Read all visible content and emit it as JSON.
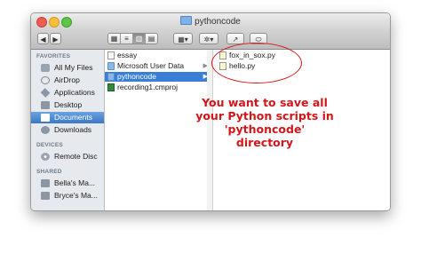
{
  "window": {
    "title": "pythoncode"
  },
  "toolbar": {
    "back": "◀",
    "forward": "▶",
    "view_modes": [
      "▦",
      "≡",
      "▥",
      "▤"
    ],
    "arrange": "▦▾",
    "action": "✲▾",
    "share": "↗",
    "tags": "⬭"
  },
  "sidebar": {
    "favorites_header": "FAVORITES",
    "favorites": [
      {
        "label": "All My Files",
        "icon": "all-files-icon"
      },
      {
        "label": "AirDrop",
        "icon": "airdrop-icon"
      },
      {
        "label": "Applications",
        "icon": "applications-icon"
      },
      {
        "label": "Desktop",
        "icon": "desktop-icon"
      },
      {
        "label": "Documents",
        "icon": "documents-icon",
        "selected": true
      },
      {
        "label": "Downloads",
        "icon": "downloads-icon"
      }
    ],
    "devices_header": "DEVICES",
    "devices": [
      {
        "label": "Remote Disc",
        "icon": "disc-icon"
      }
    ],
    "shared_header": "SHARED",
    "shared": [
      {
        "label": "Bella's Ma...",
        "icon": "computer-icon"
      },
      {
        "label": "Bryce's Ma...",
        "icon": "computer-icon"
      }
    ]
  },
  "column1": [
    {
      "label": "essay",
      "type": "doc"
    },
    {
      "label": "Microsoft User Data",
      "type": "folder"
    },
    {
      "label": "pythoncode",
      "type": "folder",
      "selected": true
    },
    {
      "label": "recording1.cmproj",
      "type": "project"
    }
  ],
  "column2": [
    {
      "label": "fox_in_sox.py",
      "type": "python"
    },
    {
      "label": "hello.py",
      "type": "python"
    }
  ],
  "annotation": {
    "color": "#d4161a",
    "lines": [
      "You want to save all",
      "your Python scripts in",
      "'pythoncode'",
      "directory"
    ]
  }
}
